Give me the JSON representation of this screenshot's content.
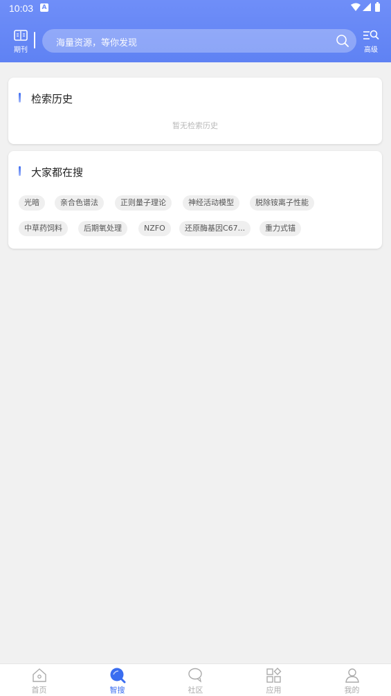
{
  "status_bar": {
    "time": "10:03",
    "notification_badge": "A"
  },
  "header": {
    "journal_label": "期刊",
    "search_placeholder": "海量资源，等你发现",
    "advanced_label": "高级"
  },
  "history": {
    "title": "检索历史",
    "empty_text": "暂无检索历史"
  },
  "popular": {
    "title": "大家都在搜",
    "tags": [
      "光暗",
      "亲合色谱法",
      "正则量子理论",
      "神经活动模型",
      "脱除铵离子性能",
      "中草药饲料",
      "后期氧处理",
      "NZFO",
      "还原酶基因C67...",
      "重力式锚"
    ]
  },
  "bottom_nav": {
    "items": [
      {
        "label": "首页",
        "icon": "home-icon",
        "active": false
      },
      {
        "label": "智搜",
        "icon": "smart-search-icon",
        "active": true
      },
      {
        "label": "社区",
        "icon": "community-icon",
        "active": false
      },
      {
        "label": "应用",
        "icon": "apps-icon",
        "active": false
      },
      {
        "label": "我的",
        "icon": "profile-icon",
        "active": false
      }
    ]
  },
  "colors": {
    "header_blue": "#6f8ef8",
    "accent": "#3a6df0",
    "tag_bg": "#efefef",
    "page_bg": "#f1f1f1"
  }
}
